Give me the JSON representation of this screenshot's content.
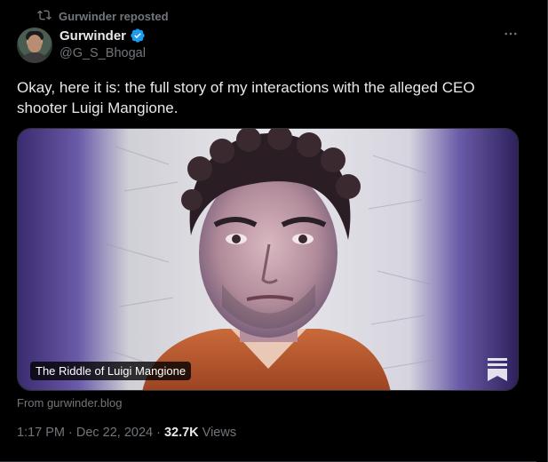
{
  "repost": {
    "label": "Gurwinder reposted",
    "icon": "repost-icon"
  },
  "author": {
    "display_name": "Gurwinder",
    "handle": "@G_S_Bhogal",
    "verified_icon": "verified-badge-icon",
    "verified_color": "#1d9bf0"
  },
  "more_icon": "more-horizontal-icon",
  "tweet": {
    "text": "Okay, here it is: the full story of my interactions with the alleged CEO shooter Luigi Mangione."
  },
  "card": {
    "title": "The Riddle of Luigi Mangione",
    "bookmark_icon": "substack-bookmark-icon",
    "source": "From gurwinder.blog"
  },
  "meta": {
    "time": "1:17 PM",
    "separator": "·",
    "date": "Dec 22, 2024",
    "separator2": "·",
    "views_count": "32.7K",
    "views_label": "Views"
  },
  "colors": {
    "background": "#000000",
    "text_primary": "#e7e9ea",
    "text_secondary": "#71767b",
    "border": "#2f3336",
    "accent": "#1d9bf0"
  }
}
